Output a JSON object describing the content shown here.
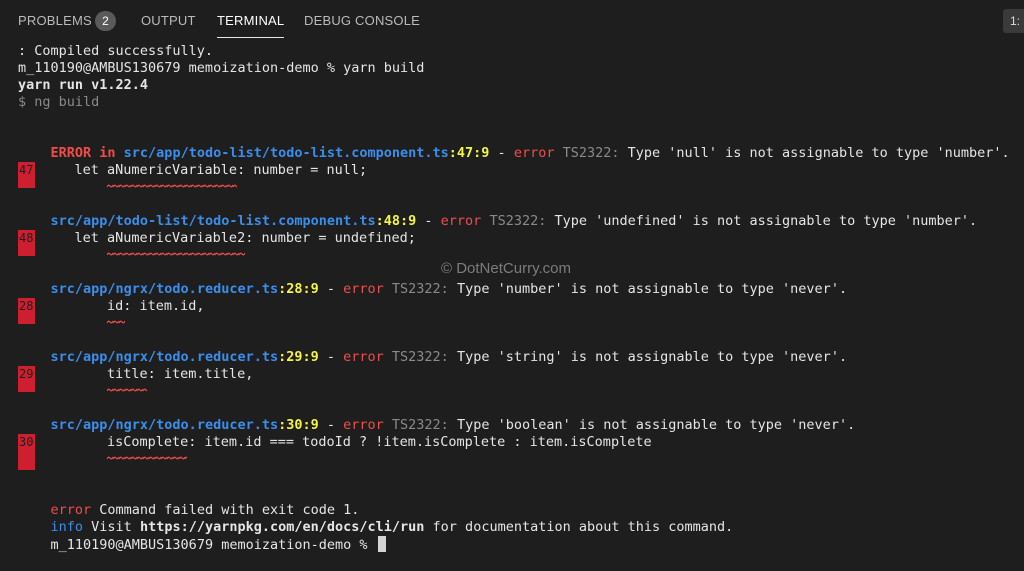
{
  "tabs": [
    {
      "label": "PROBLEMS",
      "badge": "2"
    },
    {
      "label": "OUTPUT"
    },
    {
      "label": "TERMINAL"
    },
    {
      "label": "DEBUG CONSOLE"
    }
  ],
  "panel_indicator": "1:",
  "watermark": "© DotNetCurry.com",
  "terminal": {
    "compiled": ": Compiled successfully.",
    "prompt1": "m_110190@AMBUS130679 memoization-demo % yarn build",
    "yarn_run": "yarn run v1.22.4",
    "ng_build": "$ ng build",
    "error_prefix": "ERROR in ",
    "dash": " - ",
    "error_word": "error",
    "errors": [
      {
        "file": "src/app/todo-list/todo-list.component.ts",
        "pos": ":47:9",
        "code": "TS2322:",
        "message": " Type 'null' is not assignable to type 'number'.",
        "line_no": "47",
        "source": "    let aNumericVariable: number = null;"
      },
      {
        "file": "src/app/todo-list/todo-list.component.ts",
        "pos": ":48:9",
        "code": "TS2322:",
        "message": " Type 'undefined' is not assignable to type 'number'.",
        "line_no": "48",
        "source": "    let aNumericVariable2: number = undefined;"
      },
      {
        "file": "src/app/ngrx/todo.reducer.ts",
        "pos": ":28:9",
        "code": "TS2322:",
        "message": " Type 'number' is not assignable to type 'never'.",
        "line_no": "28",
        "source": "        id: item.id,"
      },
      {
        "file": "src/app/ngrx/todo.reducer.ts",
        "pos": ":29:9",
        "code": "TS2322:",
        "message": " Type 'string' is not assignable to type 'never'.",
        "line_no": "29",
        "source": "        title: item.title,"
      },
      {
        "file": "src/app/ngrx/todo.reducer.ts",
        "pos": ":30:9",
        "code": "TS2322:",
        "message": " Type 'boolean' is not assignable to type 'never'.",
        "line_no": "30",
        "source": "        isComplete: item.id === todoId ? !item.isComplete : item.isComplete"
      }
    ],
    "fail_label": "error",
    "fail_text": " Command failed with exit code 1.",
    "info_label": "info",
    "info_text_1": " Visit ",
    "info_url": "https://yarnpkg.com/en/docs/cli/run",
    "info_text_2": " for documentation about this command.",
    "prompt2": "m_110190@AMBUS130679 memoization-demo % "
  },
  "colors": {
    "background": "#1e1e1e",
    "error_red": "#f14c4c",
    "path_blue": "#3b8eea",
    "position_yellow": "#f5f543",
    "gutter_red": "#cd1f2f"
  }
}
